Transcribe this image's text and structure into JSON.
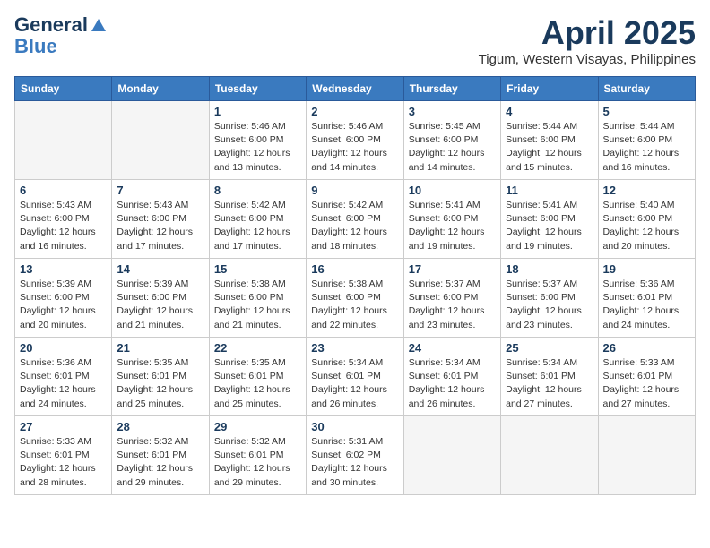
{
  "header": {
    "logo_line1": "General",
    "logo_line2": "Blue",
    "month_year": "April 2025",
    "location": "Tigum, Western Visayas, Philippines"
  },
  "weekdays": [
    "Sunday",
    "Monday",
    "Tuesday",
    "Wednesday",
    "Thursday",
    "Friday",
    "Saturday"
  ],
  "weeks": [
    [
      {
        "day": "",
        "info": ""
      },
      {
        "day": "",
        "info": ""
      },
      {
        "day": "1",
        "info": "Sunrise: 5:46 AM\nSunset: 6:00 PM\nDaylight: 12 hours\nand 13 minutes."
      },
      {
        "day": "2",
        "info": "Sunrise: 5:46 AM\nSunset: 6:00 PM\nDaylight: 12 hours\nand 14 minutes."
      },
      {
        "day": "3",
        "info": "Sunrise: 5:45 AM\nSunset: 6:00 PM\nDaylight: 12 hours\nand 14 minutes."
      },
      {
        "day": "4",
        "info": "Sunrise: 5:44 AM\nSunset: 6:00 PM\nDaylight: 12 hours\nand 15 minutes."
      },
      {
        "day": "5",
        "info": "Sunrise: 5:44 AM\nSunset: 6:00 PM\nDaylight: 12 hours\nand 16 minutes."
      }
    ],
    [
      {
        "day": "6",
        "info": "Sunrise: 5:43 AM\nSunset: 6:00 PM\nDaylight: 12 hours\nand 16 minutes."
      },
      {
        "day": "7",
        "info": "Sunrise: 5:43 AM\nSunset: 6:00 PM\nDaylight: 12 hours\nand 17 minutes."
      },
      {
        "day": "8",
        "info": "Sunrise: 5:42 AM\nSunset: 6:00 PM\nDaylight: 12 hours\nand 17 minutes."
      },
      {
        "day": "9",
        "info": "Sunrise: 5:42 AM\nSunset: 6:00 PM\nDaylight: 12 hours\nand 18 minutes."
      },
      {
        "day": "10",
        "info": "Sunrise: 5:41 AM\nSunset: 6:00 PM\nDaylight: 12 hours\nand 19 minutes."
      },
      {
        "day": "11",
        "info": "Sunrise: 5:41 AM\nSunset: 6:00 PM\nDaylight: 12 hours\nand 19 minutes."
      },
      {
        "day": "12",
        "info": "Sunrise: 5:40 AM\nSunset: 6:00 PM\nDaylight: 12 hours\nand 20 minutes."
      }
    ],
    [
      {
        "day": "13",
        "info": "Sunrise: 5:39 AM\nSunset: 6:00 PM\nDaylight: 12 hours\nand 20 minutes."
      },
      {
        "day": "14",
        "info": "Sunrise: 5:39 AM\nSunset: 6:00 PM\nDaylight: 12 hours\nand 21 minutes."
      },
      {
        "day": "15",
        "info": "Sunrise: 5:38 AM\nSunset: 6:00 PM\nDaylight: 12 hours\nand 21 minutes."
      },
      {
        "day": "16",
        "info": "Sunrise: 5:38 AM\nSunset: 6:00 PM\nDaylight: 12 hours\nand 22 minutes."
      },
      {
        "day": "17",
        "info": "Sunrise: 5:37 AM\nSunset: 6:00 PM\nDaylight: 12 hours\nand 23 minutes."
      },
      {
        "day": "18",
        "info": "Sunrise: 5:37 AM\nSunset: 6:00 PM\nDaylight: 12 hours\nand 23 minutes."
      },
      {
        "day": "19",
        "info": "Sunrise: 5:36 AM\nSunset: 6:01 PM\nDaylight: 12 hours\nand 24 minutes."
      }
    ],
    [
      {
        "day": "20",
        "info": "Sunrise: 5:36 AM\nSunset: 6:01 PM\nDaylight: 12 hours\nand 24 minutes."
      },
      {
        "day": "21",
        "info": "Sunrise: 5:35 AM\nSunset: 6:01 PM\nDaylight: 12 hours\nand 25 minutes."
      },
      {
        "day": "22",
        "info": "Sunrise: 5:35 AM\nSunset: 6:01 PM\nDaylight: 12 hours\nand 25 minutes."
      },
      {
        "day": "23",
        "info": "Sunrise: 5:34 AM\nSunset: 6:01 PM\nDaylight: 12 hours\nand 26 minutes."
      },
      {
        "day": "24",
        "info": "Sunrise: 5:34 AM\nSunset: 6:01 PM\nDaylight: 12 hours\nand 26 minutes."
      },
      {
        "day": "25",
        "info": "Sunrise: 5:34 AM\nSunset: 6:01 PM\nDaylight: 12 hours\nand 27 minutes."
      },
      {
        "day": "26",
        "info": "Sunrise: 5:33 AM\nSunset: 6:01 PM\nDaylight: 12 hours\nand 27 minutes."
      }
    ],
    [
      {
        "day": "27",
        "info": "Sunrise: 5:33 AM\nSunset: 6:01 PM\nDaylight: 12 hours\nand 28 minutes."
      },
      {
        "day": "28",
        "info": "Sunrise: 5:32 AM\nSunset: 6:01 PM\nDaylight: 12 hours\nand 29 minutes."
      },
      {
        "day": "29",
        "info": "Sunrise: 5:32 AM\nSunset: 6:01 PM\nDaylight: 12 hours\nand 29 minutes."
      },
      {
        "day": "30",
        "info": "Sunrise: 5:31 AM\nSunset: 6:02 PM\nDaylight: 12 hours\nand 30 minutes."
      },
      {
        "day": "",
        "info": ""
      },
      {
        "day": "",
        "info": ""
      },
      {
        "day": "",
        "info": ""
      }
    ]
  ]
}
